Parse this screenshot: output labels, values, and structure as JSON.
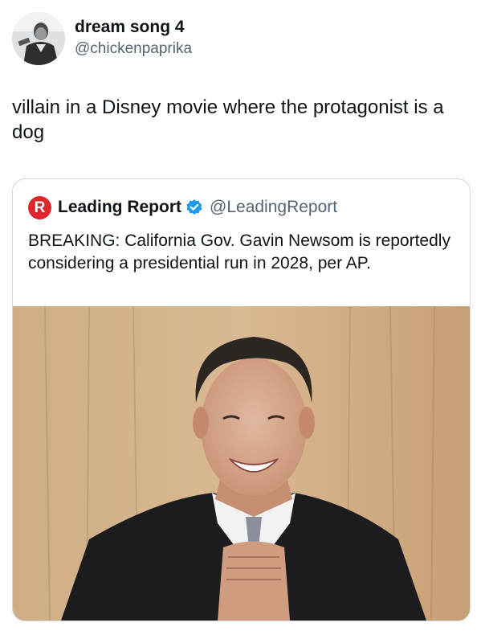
{
  "tweet": {
    "author": {
      "name": "dream song 4",
      "handle": "@chickenpaprika",
      "avatar_icon": "profile-photo"
    },
    "text": "villain in a Disney movie where the protagonist is a dog"
  },
  "quote": {
    "logo_letter": "R",
    "logo_color": "#e0252c",
    "author_name": "Leading Report",
    "verified_icon": "verified-badge-icon",
    "verified_color": "#1d9bf0",
    "handle": "@LeadingReport",
    "text": "BREAKING: California Gov. Gavin Newsom is reportedly considering a presidential run in 2028, per AP.",
    "media": {
      "description_icon": "photo-smiling-man-in-suit",
      "background_color": "#c9a57f"
    }
  }
}
